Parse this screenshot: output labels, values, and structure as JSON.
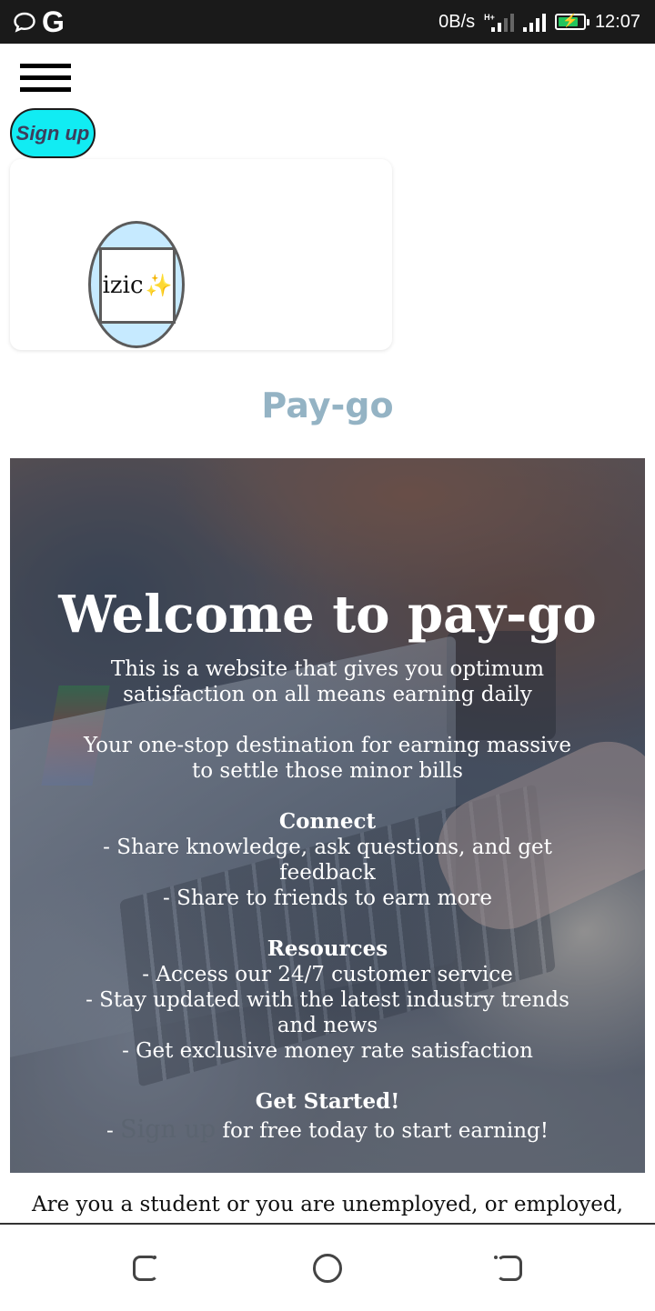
{
  "status_bar": {
    "network_speed": "0B/s",
    "network_type": "H+",
    "time": "12:07",
    "battery_color": "#22c55e"
  },
  "header": {
    "signup_label": "Sign up",
    "menu_icon": "hamburger-menu-icon"
  },
  "logo": {
    "text": "izic",
    "sparkle": "✨",
    "oval_color": "#c6eaff"
  },
  "brand": {
    "title": "Pay-go",
    "title_color": "#94b3c4"
  },
  "hero": {
    "heading": "Welcome to pay-go",
    "intro": "This is a website that gives you optimum satisfaction on all means earning daily",
    "tagline": "Your one-stop destination for earning massive to settle those minor bills",
    "connect": {
      "title": "Connect",
      "items": [
        "- Share knowledge, ask questions, and get feedback",
        "- Share to friends to earn more"
      ]
    },
    "resources": {
      "title": "Resources",
      "items": [
        "- Access our 24/7 customer service",
        "- Stay updated with the latest industry trends and news",
        "- Get exclusive money rate satisfaction"
      ]
    },
    "get_started": {
      "title": "Get Started!",
      "prefix": "- ",
      "link": "Sign up",
      "suffix": " for free today to start earning!"
    }
  },
  "body_text": "Are you a student or you are unemployed, or employed, in need of a liquid cash to settle some bills",
  "nav_bar": {
    "back_icon": "back-icon",
    "home_icon": "home-icon",
    "recent_icon": "recent-apps-icon"
  }
}
